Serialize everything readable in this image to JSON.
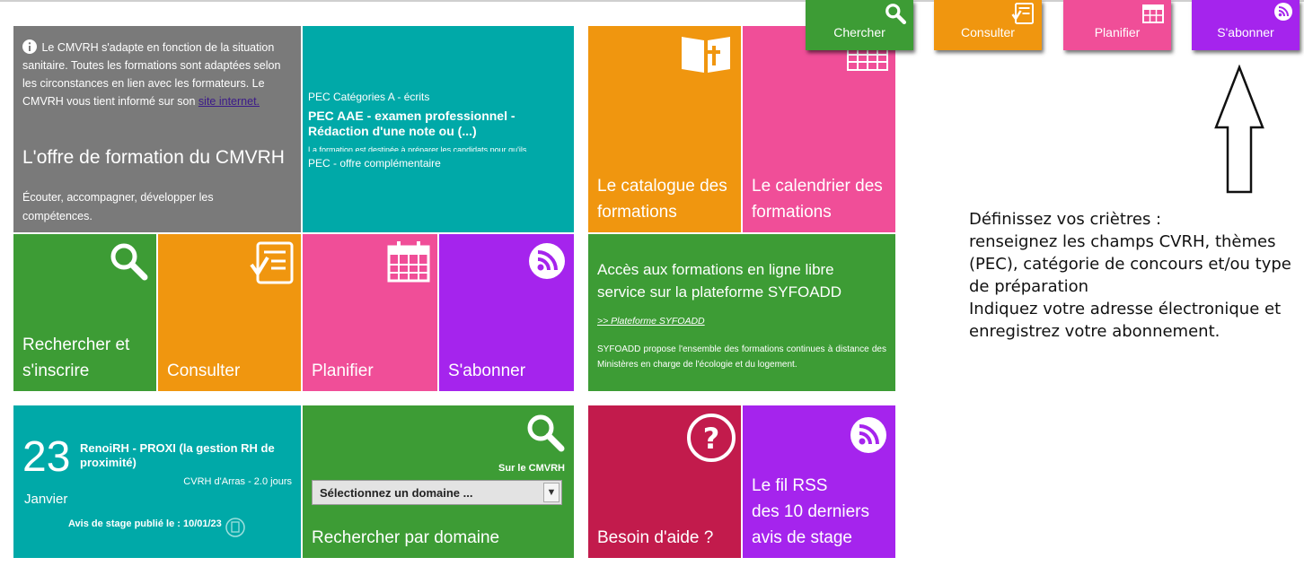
{
  "shortcuts": {
    "search": "Chercher",
    "consult": "Consulter",
    "plan": "Planifier",
    "subscribe": "S'abonner"
  },
  "info_tile": {
    "notice_text": "Le CMVRH s'adapte en fonction de la situation sanitaire. Toutes les formations sont adaptées selon les circonstances en lien avec les formateurs. Le CMVRH vous tient informé sur son",
    "link": "site internet.",
    "title": "L'offre de formation du CMVRH",
    "tagline": "Écouter, accompagner, développer les compétences."
  },
  "pec_tile": {
    "category": "PEC Catégories A - écrits",
    "headline": "PEC AAE - examen professionnel - Rédaction d'une note ou (...)",
    "excerpt": "La formation est destinée à préparer les candidats pour qu'ils",
    "footer": "PEC - offre complémentaire"
  },
  "catalogue_tile": {
    "label": "Le catalogue des formations"
  },
  "calendar_tile": {
    "label": "Le calendrier des formations"
  },
  "search_tile": {
    "label": "Rechercher et s'inscrire"
  },
  "consult_tile": {
    "label": "Consulter"
  },
  "plan_tile": {
    "label": "Planifier"
  },
  "subscribe_tile": {
    "label": "S'abonner"
  },
  "syfoadd_tile": {
    "title": "Accès aux formations en ligne libre service sur la plateforme SYFOADD",
    "link": ">> Plateforme SYFOADD",
    "description": "SYFOADD propose l'ensemble des formations continues à distance des Ministères en charge de l'écologie et du logement."
  },
  "event_tile": {
    "day": "23",
    "month": "Janvier",
    "title": "RenoiRH - PROXI (la gestion RH de proximité)",
    "meta": "CVRH d'Arras - 2.0 jours",
    "published": "Avis de stage publié le : 10/01/23"
  },
  "domain_tile": {
    "scope": "Sur le CMVRH",
    "select_value": "Sélectionnez un domaine ...",
    "label": "Rechercher par domaine"
  },
  "help_tile": {
    "label": "Besoin d'aide ?"
  },
  "rss_tile": {
    "line1": "Le fil RSS",
    "line2": "des 10 derniers",
    "line3": "avis de stage"
  },
  "instructions": {
    "line1": "Définissez vos criètres :",
    "line2": "renseignez les champs CVRH, thèmes (PEC), catégorie de concours et/ou type de préparation",
    "line3": "Indiquez votre adresse électronique et enregistrez votre abonnement."
  },
  "colors": {
    "grey": "#7a7a7a",
    "teal": "#00a9a8",
    "orange": "#f0960f",
    "pink": "#f04e98",
    "green": "#3d9c35",
    "purple": "#a524ed",
    "crimson": "#c21b4c"
  }
}
